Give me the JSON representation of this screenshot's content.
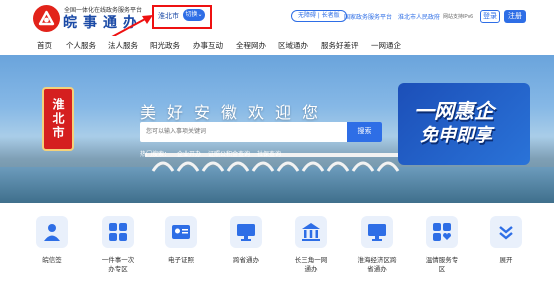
{
  "header": {
    "logo_subtitle": "全国一体化在线政务服务平台",
    "logo_title": "皖事通办",
    "city": "淮北市",
    "switch_label": "切换",
    "access_links": [
      "无障碍",
      "长者版"
    ],
    "links": [
      "国家政务服务平台",
      "淮北市人民政府"
    ],
    "ipv6_text": "网站支持IPv6",
    "login_label": "登录",
    "register_label": "注册"
  },
  "nav": {
    "items": [
      "首页",
      "个人服务",
      "法人服务",
      "阳光政务",
      "办事互动",
      "全程网办",
      "区域通办",
      "服务好差评",
      "一网通企"
    ]
  },
  "hero": {
    "badge_text": "淮北市",
    "title": "美好安徽欢迎您",
    "search_placeholder": "您可以输入事项关键词",
    "search_button": "搜索",
    "hot_label": "热门搜索：",
    "hot_items": [
      "企业开办",
      "证照公积金查询",
      "社保查询"
    ],
    "promo_line1": "一网惠企",
    "promo_line2": "免申即享"
  },
  "services": [
    {
      "label": "皖信签",
      "icon": "person-icon"
    },
    {
      "label": "一件事一次办专区",
      "icon": "grid-icon"
    },
    {
      "label": "电子证照",
      "icon": "id-card-icon"
    },
    {
      "label": "跨省通办",
      "icon": "monitor-icon"
    },
    {
      "label": "长三角一网通办",
      "icon": "bank-icon"
    },
    {
      "label": "淮海经济区跨省通办",
      "icon": "monitor-icon"
    },
    {
      "label": "温情服务专区",
      "icon": "heart-icon"
    },
    {
      "label": "展开",
      "icon": "chevron-down-icon"
    }
  ]
}
